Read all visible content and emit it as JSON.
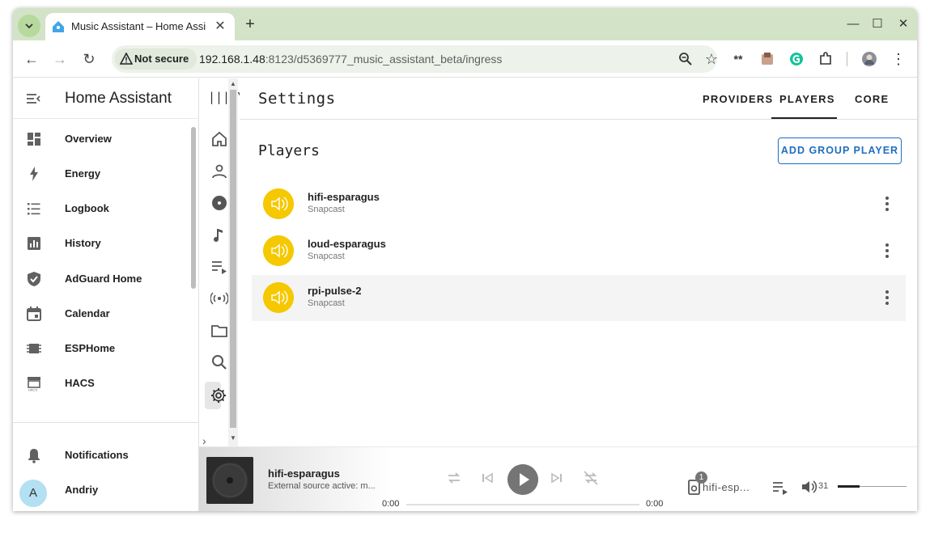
{
  "browser": {
    "tab_title": "Music Assistant – Home Assi",
    "security_label": "Not secure",
    "url_host": "192.168.1.48",
    "url_path": ":8123/d5369777_music_assistant_beta/ingress",
    "extension_text": "**"
  },
  "ha_sidebar": {
    "title": "Home Assistant",
    "items": [
      {
        "label": "Overview",
        "icon": "dashboard-icon"
      },
      {
        "label": "Energy",
        "icon": "lightning-icon"
      },
      {
        "label": "Logbook",
        "icon": "list-icon"
      },
      {
        "label": "History",
        "icon": "chart-icon"
      },
      {
        "label": "AdGuard Home",
        "icon": "shield-icon"
      },
      {
        "label": "Calendar",
        "icon": "calendar-icon"
      },
      {
        "label": "ESPHome",
        "icon": "chip-icon"
      },
      {
        "label": "HACS",
        "icon": "store-icon"
      }
    ],
    "notifications_label": "Notifications",
    "user_name": "Andriy",
    "user_initial": "A"
  },
  "ma_rail": {
    "logo_text": "|||/\\"
  },
  "settings": {
    "title": "Settings",
    "tabs": [
      {
        "label": "PROVIDERS",
        "active": false
      },
      {
        "label": "PLAYERS",
        "active": true
      },
      {
        "label": "CORE",
        "active": false
      }
    ],
    "section_title": "Players",
    "add_group_label": "ADD GROUP PLAYER",
    "players": [
      {
        "name": "hifi-esparagus",
        "provider": "Snapcast"
      },
      {
        "name": "loud-esparagus",
        "provider": "Snapcast"
      },
      {
        "name": "rpi-pulse-2",
        "provider": "Snapcast"
      }
    ]
  },
  "player_bar": {
    "title": "hifi-esparagus",
    "subtitle": "External source active: m...",
    "time_elapsed": "0:00",
    "time_total": "0:00",
    "queue_count": "1",
    "active_player": "hifi-esp...",
    "volume": "31"
  },
  "colors": {
    "accent": "#1e6ec0",
    "player_icon_bg": "#f5c800",
    "tabstrip_bg": "#d3e3c7"
  }
}
